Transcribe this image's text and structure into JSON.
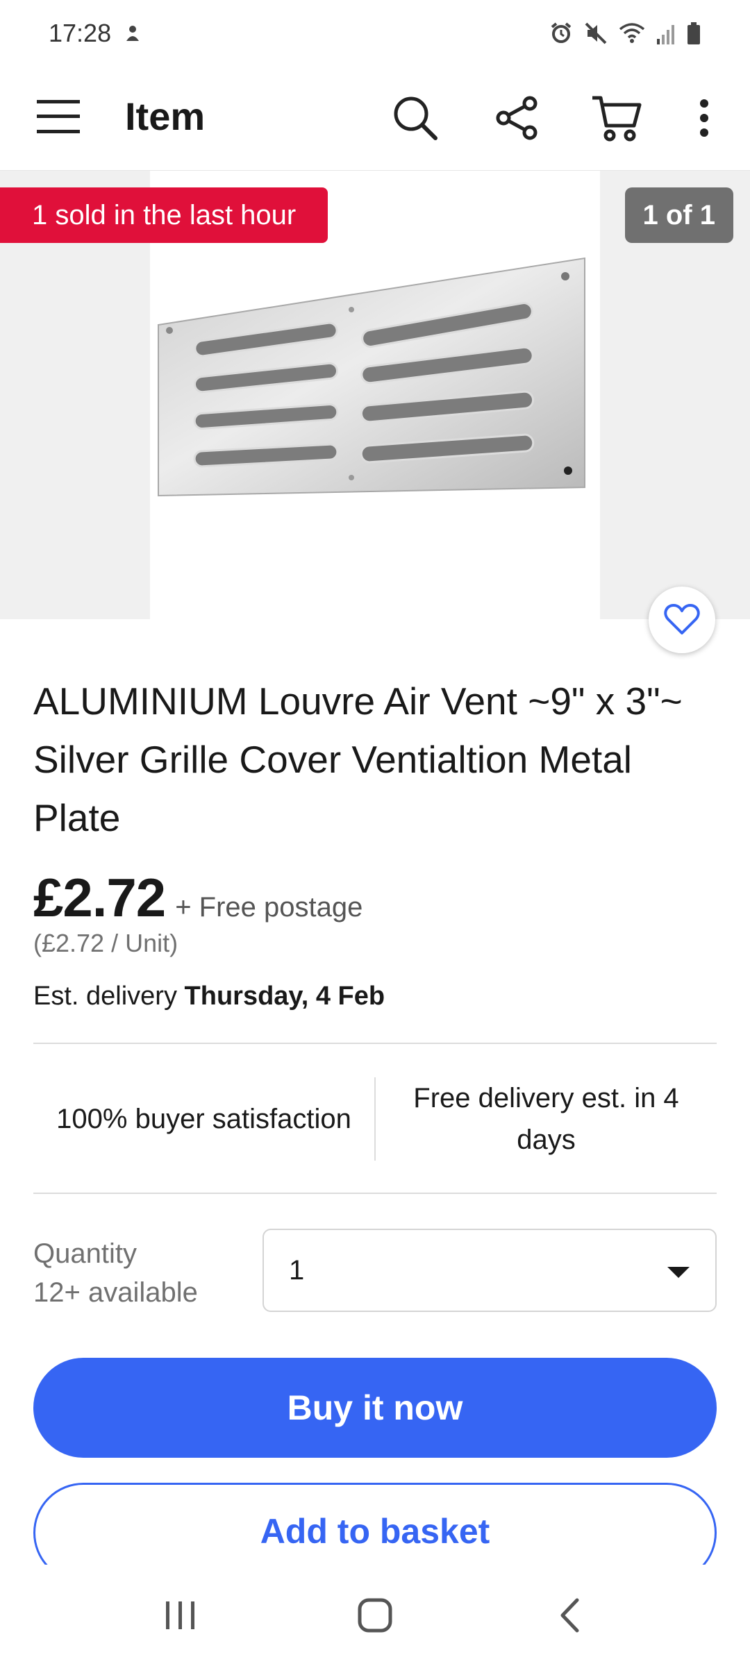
{
  "status_bar": {
    "time": "17:28"
  },
  "app_bar": {
    "title": "Item"
  },
  "gallery": {
    "sold_badge": "1 sold in the last hour",
    "image_count": "1 of 1"
  },
  "item": {
    "title": "ALUMINIUM Louvre Air Vent ~9\" x 3\"~ Silver Grille Cover Ventialtion Metal Plate",
    "price": "£2.72",
    "postage": "+ Free postage",
    "unit_price": "(£2.72 / Unit)",
    "delivery_label": "Est. delivery",
    "delivery_date": "Thursday, 4 Feb"
  },
  "highlights": {
    "satisfaction": "100% buyer satisfaction",
    "free_delivery": "Free delivery est. in 4 days"
  },
  "quantity": {
    "label": "Quantity",
    "available": "12+ available",
    "selected": "1"
  },
  "actions": {
    "buy_now": "Buy it now",
    "add_to_basket": "Add to basket"
  },
  "colors": {
    "accent_blue": "#3665f3",
    "badge_red": "#e0103a",
    "badge_gray": "#707070"
  }
}
